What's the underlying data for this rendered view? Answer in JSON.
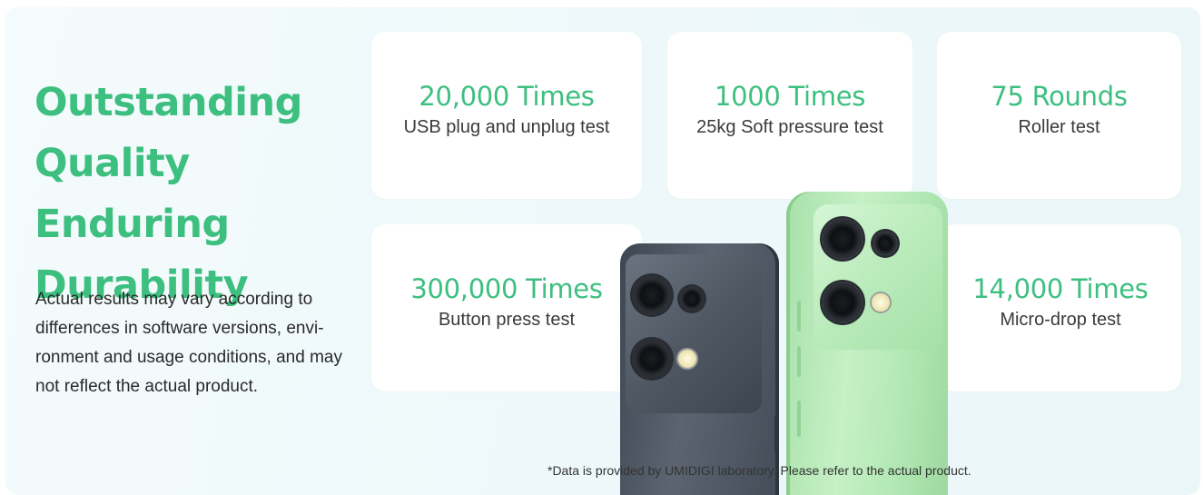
{
  "headline": "Outstanding Quality Enduring Durability",
  "disclaimer": "Actual results may vary according to differences in software versions, envi-ronment and usage conditions, and may not reflect the actual product.",
  "cards": [
    {
      "value": "20,000 Times",
      "label": "USB plug and unplug test"
    },
    {
      "value": "1000 Times",
      "label": "25kg Soft pressure test"
    },
    {
      "value": "75 Rounds",
      "label": "Roller test"
    },
    {
      "value": "300,000 Times",
      "label": "Button press test"
    },
    {
      "value": "14,000 Times",
      "label": "Micro-drop test"
    }
  ],
  "footnote": "*Data is provided by UMIDIGI laboratory. Please refer to the actual product.",
  "colors": {
    "accent": "#3dbf80",
    "background": "#eef8fa",
    "card": "#ffffff",
    "phone_dark": "#4a525d",
    "phone_green": "#b9e9ba"
  }
}
